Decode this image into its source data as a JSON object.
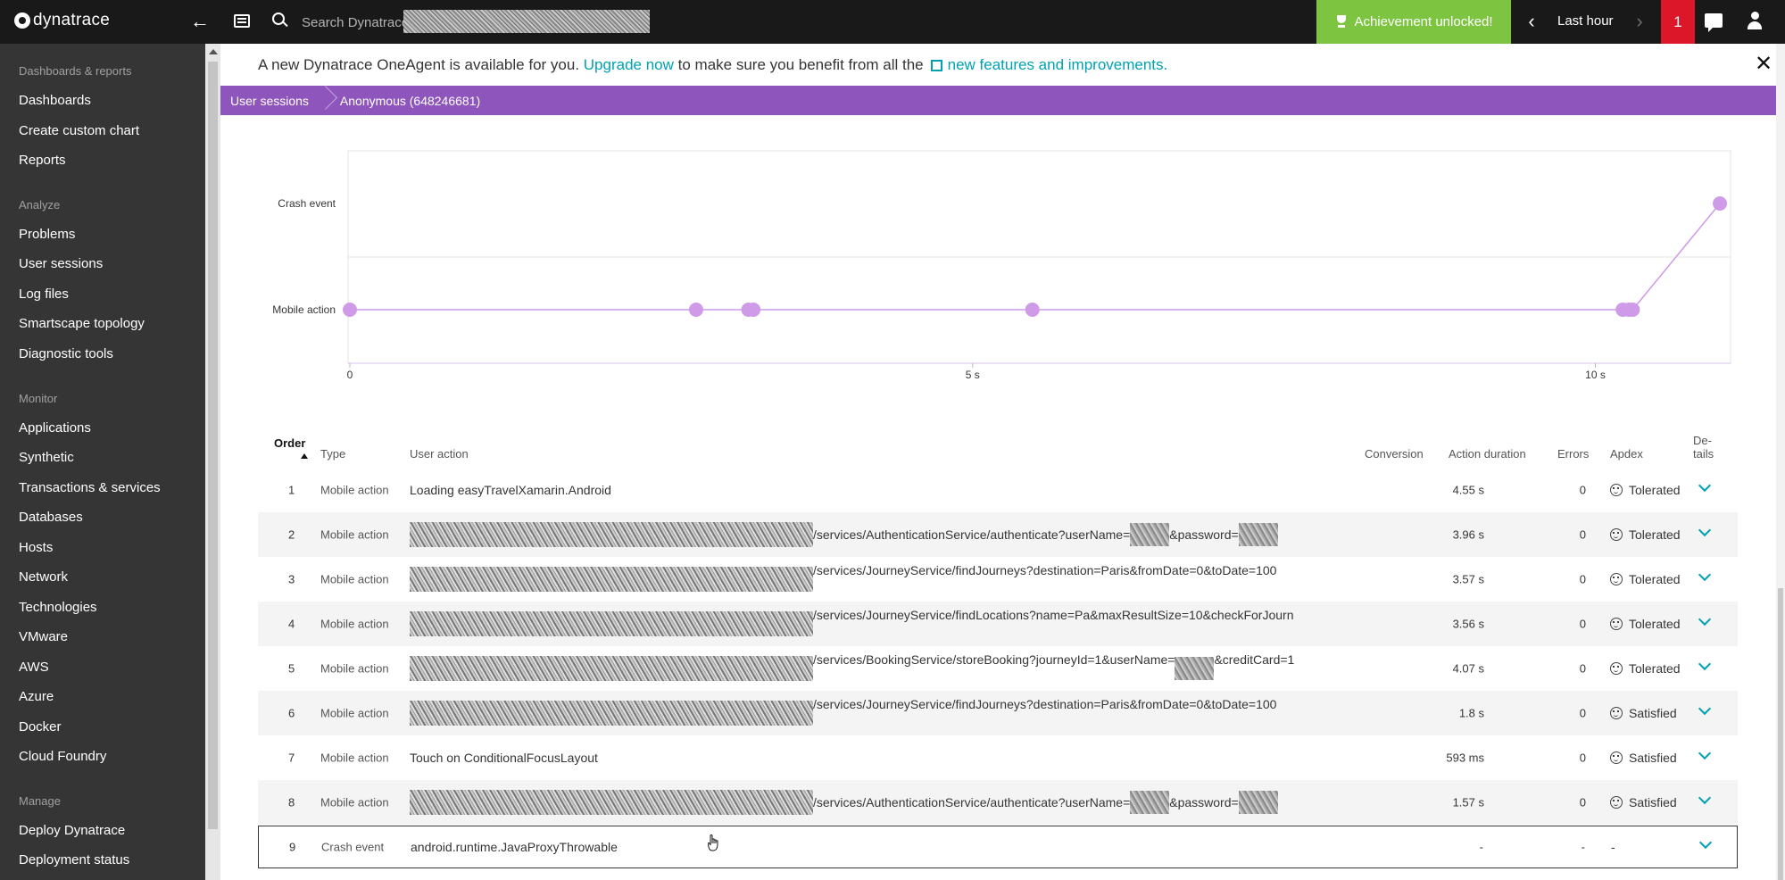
{
  "topbar": {
    "logo_text": "dynatrace",
    "search_placeholder": "Search Dynatrace",
    "achievement_label": "Achievement unlocked!",
    "timeframe_label": "Last hour",
    "problems_count": "1"
  },
  "sidebar": {
    "sections": [
      {
        "title": "Dashboards & reports",
        "items": [
          "Dashboards",
          "Create custom chart",
          "Reports"
        ]
      },
      {
        "title": "Analyze",
        "items": [
          "Problems",
          "User sessions",
          "Log files",
          "Smartscape topology",
          "Diagnostic tools"
        ]
      },
      {
        "title": "Monitor",
        "items": [
          "Applications",
          "Synthetic",
          "Transactions & services",
          "Databases",
          "Hosts",
          "Network",
          "Technologies",
          "VMware",
          "AWS",
          "Azure",
          "Docker",
          "Cloud Foundry"
        ]
      },
      {
        "title": "Manage",
        "items": [
          "Deploy Dynatrace",
          "Deployment status"
        ]
      }
    ]
  },
  "banner": {
    "text_before": "A new Dynatrace OneAgent is available for you.",
    "upgrade_link": "Upgrade now",
    "text_middle": "to make sure you benefit from all the",
    "features_link": "new features and improvements."
  },
  "breadcrumb": [
    "User sessions",
    "Anonymous (648246681)"
  ],
  "chart_data": {
    "type": "scatter",
    "categories": [
      "Crash event",
      "Mobile action"
    ],
    "x_ticks": [
      "0",
      "5 s",
      "10 s"
    ],
    "xlim": [
      0,
      11.1
    ],
    "points": [
      {
        "x": 0,
        "y": "Mobile action"
      },
      {
        "x": 2.78,
        "y": "Mobile action"
      },
      {
        "x": 3.2,
        "y": "Mobile action"
      },
      {
        "x": 3.24,
        "y": "Mobile action"
      },
      {
        "x": 5.48,
        "y": "Mobile action"
      },
      {
        "x": 10.22,
        "y": "Mobile action"
      },
      {
        "x": 10.27,
        "y": "Mobile action"
      },
      {
        "x": 10.3,
        "y": "Mobile action"
      },
      {
        "x": 11.0,
        "y": "Crash event"
      }
    ],
    "color": "#cf9ae8",
    "grid": true
  },
  "table": {
    "headers": {
      "order": "Order",
      "type": "Type",
      "action": "User action",
      "conversion": "Conversion",
      "duration": "Action duration",
      "errors": "Errors",
      "apdex": "Apdex",
      "details": "De-tails"
    },
    "rows": [
      {
        "order": "1",
        "type": "Mobile action",
        "action": "Loading easyTravelXamarin.Android",
        "redacted": false,
        "duration": "4.55 s",
        "errors": "0",
        "apdex": "Tolerated"
      },
      {
        "order": "2",
        "type": "Mobile action",
        "path": "/services/AuthenticationService/authenticate?userName=",
        "path2": "&password=",
        "redacted": true,
        "duration": "3.96 s",
        "errors": "0",
        "apdex": "Tolerated"
      },
      {
        "order": "3",
        "type": "Mobile action",
        "path": "/services/JourneyService/findJourneys?destination=Paris&fromDate=0&toDate=100",
        "redacted": true,
        "duration": "3.57 s",
        "errors": "0",
        "apdex": "Tolerated"
      },
      {
        "order": "4",
        "type": "Mobile action",
        "path": "/services/JourneyService/findLocations?name=Pa&maxResultSize=10&checkForJourn",
        "redacted": true,
        "duration": "3.56 s",
        "errors": "0",
        "apdex": "Tolerated"
      },
      {
        "order": "5",
        "type": "Mobile action",
        "path": "/services/BookingService/storeBooking?journeyId=1&userName=",
        "path2": "&creditCard=1",
        "redacted": true,
        "duration": "4.07 s",
        "errors": "0",
        "apdex": "Tolerated"
      },
      {
        "order": "6",
        "type": "Mobile action",
        "path": "/services/JourneyService/findJourneys?destination=Paris&fromDate=0&toDate=100",
        "redacted": true,
        "duration": "1.8 s",
        "errors": "0",
        "apdex": "Satisfied"
      },
      {
        "order": "7",
        "type": "Mobile action",
        "action": "Touch on ConditionalFocusLayout",
        "redacted": false,
        "duration": "593 ms",
        "errors": "0",
        "apdex": "Satisfied"
      },
      {
        "order": "8",
        "type": "Mobile action",
        "path": "/services/AuthenticationService/authenticate?userName=",
        "path2": "&password=",
        "redacted": true,
        "duration": "1.57 s",
        "errors": "0",
        "apdex": "Satisfied"
      },
      {
        "order": "9",
        "type": "Crash event",
        "action": "android.runtime.JavaProxyThrowable",
        "redacted": false,
        "duration": "-",
        "errors": "-",
        "apdex": "-"
      }
    ]
  }
}
